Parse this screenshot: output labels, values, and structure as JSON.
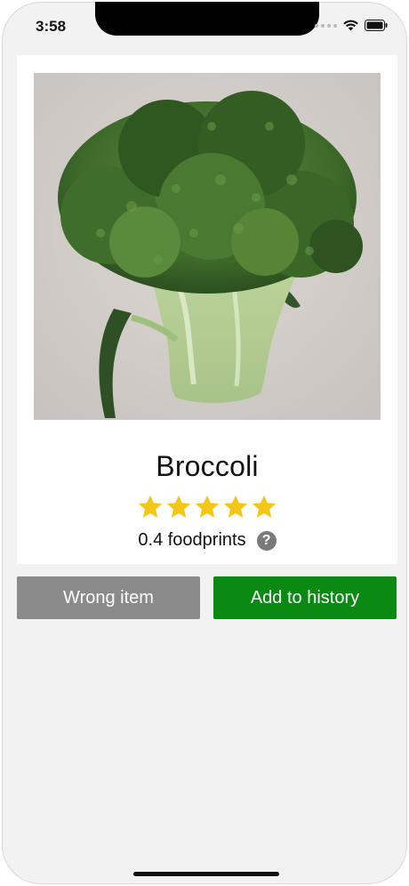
{
  "status_bar": {
    "time": "3:58",
    "wifi_icon": "wifi-icon",
    "battery_icon": "battery-icon"
  },
  "result": {
    "item_name": "Broccoli",
    "rating": {
      "value": 5,
      "max": 5,
      "color": "#f5c518"
    },
    "foodprints_text": "0.4 foodprints",
    "help_glyph": "?"
  },
  "actions": {
    "wrong_item_label": "Wrong item",
    "add_to_history_label": "Add to history",
    "colors": {
      "wrong_item": "#8a8a8a",
      "add_to_history": "#0a8a13"
    }
  }
}
